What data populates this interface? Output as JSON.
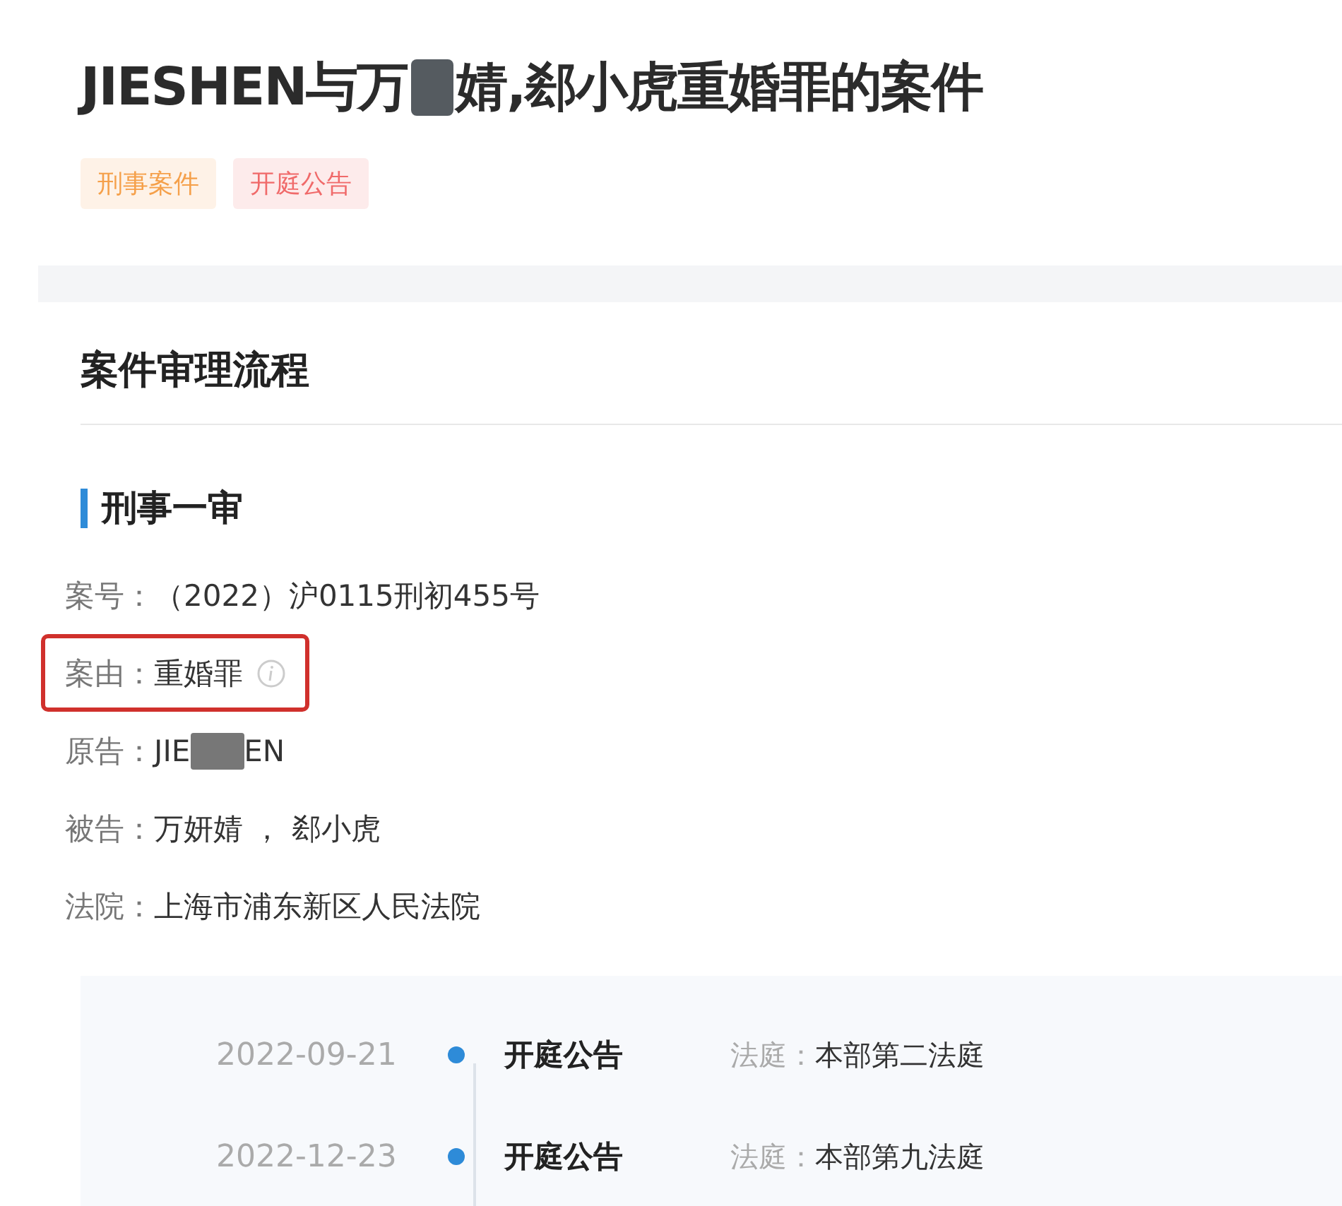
{
  "title_parts": [
    "JIESHEN与万",
    "婧,郄小虎重婚罪的案件"
  ],
  "tags": [
    {
      "label": "刑事案件",
      "color": "#f5a04a"
    },
    {
      "label": "开庭公告",
      "color": "#f06a6a"
    }
  ],
  "section": {
    "title": "案件审理流程"
  },
  "stage": {
    "title": "刑事一审",
    "fields": [
      {
        "label": "案号：",
        "value_parts": [
          "（2022）沪0115刑初455号"
        ],
        "highlighted": false,
        "info_icon": false
      },
      {
        "label": "案由：",
        "value_parts": [
          "重婚罪"
        ],
        "highlighted": true,
        "info_icon": true
      },
      {
        "label": "原告：",
        "value_parts": [
          "JIE",
          "EN"
        ],
        "highlighted": false,
        "info_icon": false
      },
      {
        "label": "被告：",
        "value_parts": [
          "万妍婧 ， 郄小虎"
        ],
        "highlighted": false,
        "info_icon": false
      },
      {
        "label": "法院：",
        "value_parts": [
          "上海市浦东新区人民法院"
        ],
        "highlighted": false,
        "info_icon": false
      }
    ]
  },
  "timeline": [
    {
      "date": "2022-09-21",
      "event": "开庭公告",
      "label": "法庭：",
      "value": "本部第二法庭"
    },
    {
      "date": "2022-12-23",
      "event": "开庭公告",
      "label": "法庭：",
      "value": "本部第九法庭"
    }
  ]
}
